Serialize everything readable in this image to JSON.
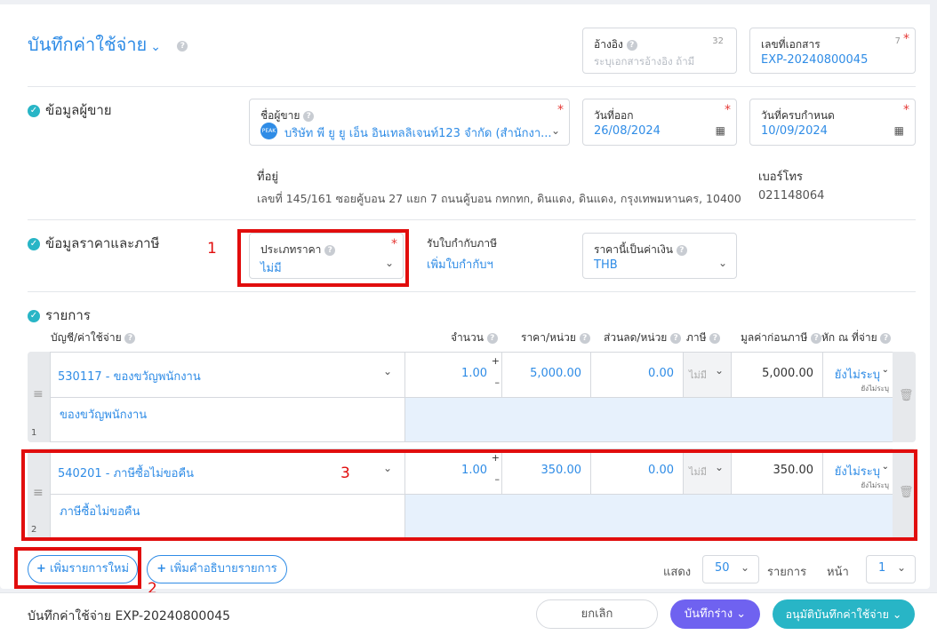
{
  "header": {
    "title": "บันทึกค่าใช้จ่าย",
    "reference": {
      "label": "อ้างอิง",
      "counter": "32",
      "placeholder": "ระบุเอกสารอ้างอิง ถ้ามี"
    },
    "doc_number": {
      "label": "เลขที่เอกสาร",
      "counter": "7",
      "value": "EXP-20240800045"
    }
  },
  "vendor": {
    "section_title": "ข้อมูลผู้ขาย",
    "name_label": "ชื่อผู้ขาย",
    "avatar_text": "PEAK",
    "name_value": "บริษัท พี ยู ยู เอ็น อินเทลลิเจนท์123 จำกัด (สำนักงา...",
    "issue_date_label": "วันที่ออก",
    "issue_date": "26/08/2024",
    "due_date_label": "วันที่ครบกำหนด",
    "due_date": "10/09/2024",
    "address_label": "ที่อยู่",
    "address": "เลขที่ 145/161 ซอยคู้บอน 27 แยก 7 ถนนคู้บอน กทกทก, ดินแดง, ดินแดง, กรุงเทพมหานคร, 10400",
    "phone_label": "เบอร์โทร",
    "phone": "021148064"
  },
  "pricing": {
    "section_title": "ข้อมูลราคาและภาษี",
    "price_type_label": "ประเภทราคา",
    "price_type_value": "ไม่มี",
    "tax_invoice_label": "รับใบกำกับภาษี",
    "tax_invoice_link": "เพิ่มใบกำกับฯ",
    "currency_label": "ราคานี้เป็นค่าเงิน",
    "currency_value": "THB"
  },
  "items": {
    "section_title": "รายการ",
    "columns": {
      "account": "บัญชี/ค่าใช้จ่าย",
      "qty": "จำนวน",
      "price": "ราคา/หน่วย",
      "discount": "ส่วนลด/หน่วย",
      "tax": "ภาษี",
      "pretax": "มูลค่าก่อนภาษี",
      "withholding": "หัก ณ ที่จ่าย"
    },
    "rows": [
      {
        "index": "1",
        "account": "530117 - ของขวัญพนักงาน",
        "description": "ของขวัญพนักงาน",
        "qty": "1.00",
        "price": "5,000.00",
        "discount": "0.00",
        "tax": "ไม่มี",
        "pretax": "5,000.00",
        "wht": "ยังไม่ระบุ",
        "wht_sub": "ยังไม่ระบุ"
      },
      {
        "index": "2",
        "account": "540201 - ภาษีซื้อไม่ขอคืน",
        "description": "ภาษีซื้อไม่ขอคืน",
        "qty": "1.00",
        "price": "350.00",
        "discount": "0.00",
        "tax": "ไม่มี",
        "pretax": "350.00",
        "wht": "ยังไม่ระบุ",
        "wht_sub": "ยังไม่ระบุ"
      }
    ],
    "add_item": "เพิ่มรายการใหม่",
    "add_description": "เพิ่มคำอธิบายรายการ",
    "show_label": "แสดง",
    "page_size": "50",
    "items_label": "รายการ",
    "page_label": "หน้า",
    "page": "1"
  },
  "annotations": {
    "one": "1",
    "two": "2",
    "three": "3"
  },
  "footer": {
    "doc_title": "บันทึกค่าใช้จ่าย EXP-20240800045",
    "cancel": "ยกเลิก",
    "save_draft": "บันทึกร่าง",
    "approve": "อนุมัติบันทึกค่าใช้จ่าย"
  },
  "colors": {
    "accent": "#2f8ce6",
    "teal": "#28b5c6",
    "purple": "#6f62f0",
    "annotation_red": "#e10d0d"
  }
}
